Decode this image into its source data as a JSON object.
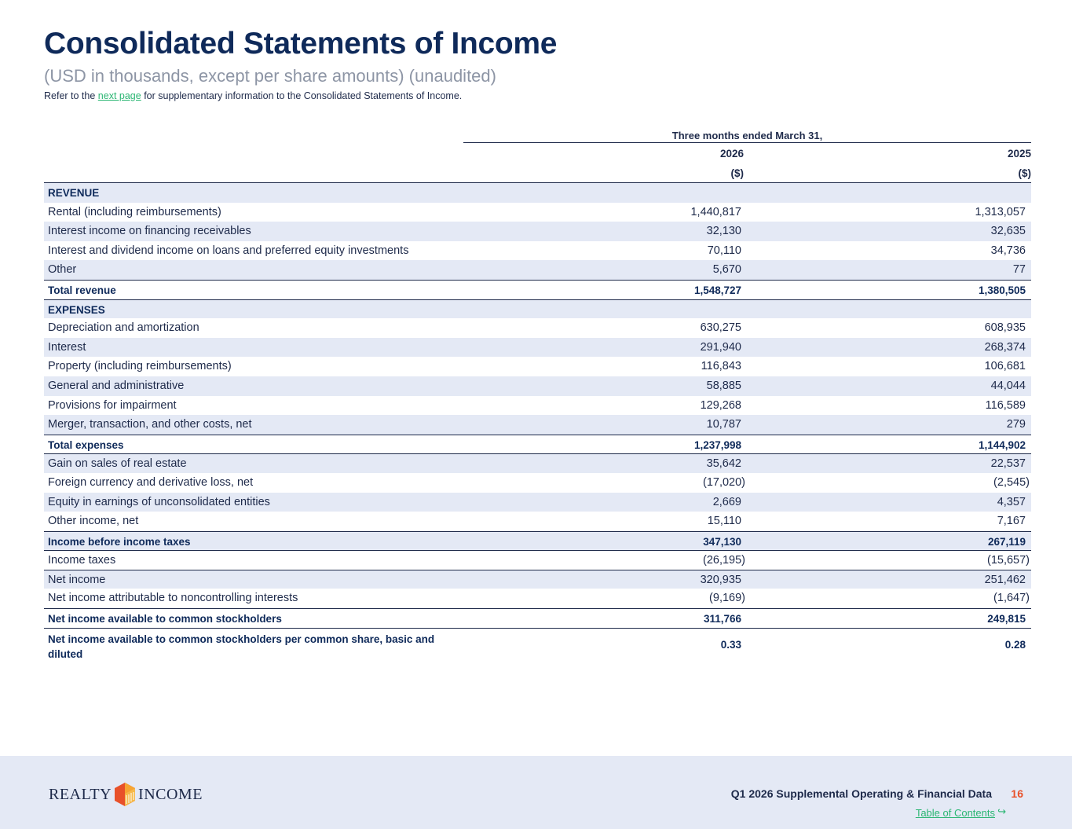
{
  "header": {
    "title": "Consolidated Statements of Income",
    "subtitle": "(USD in thousands, except per share amounts) (unaudited)",
    "note_prefix": "Refer to the ",
    "note_link": "next page",
    "note_suffix": " for supplementary information to the Consolidated Statements of Income."
  },
  "table": {
    "period_label": "Three months ended March 31,",
    "years": [
      "2026",
      "2025"
    ],
    "units": [
      "($)",
      "($)"
    ],
    "rows": [
      {
        "label": "REVENUE",
        "v1": "",
        "v2": ""
      },
      {
        "label": "Rental (including reimbursements)",
        "v1": "1,440,817",
        "v2": "1,313,057"
      },
      {
        "label": "Interest income on financing receivables",
        "v1": "32,130",
        "v2": "32,635"
      },
      {
        "label": "Interest and dividend income on loans and preferred equity investments",
        "v1": "70,110",
        "v2": "34,736"
      },
      {
        "label": "Other",
        "v1": "5,670",
        "v2": "77"
      },
      {
        "label": "Total revenue",
        "v1": "1,548,727",
        "v2": "1,380,505"
      },
      {
        "label": "EXPENSES",
        "v1": "",
        "v2": ""
      },
      {
        "label": "Depreciation and amortization",
        "v1": "630,275",
        "v2": "608,935"
      },
      {
        "label": "Interest",
        "v1": "291,940",
        "v2": "268,374"
      },
      {
        "label": "Property (including reimbursements)",
        "v1": "116,843",
        "v2": "106,681"
      },
      {
        "label": "General and administrative",
        "v1": "58,885",
        "v2": "44,044"
      },
      {
        "label": "Provisions for impairment",
        "v1": "129,268",
        "v2": "116,589"
      },
      {
        "label": "Merger, transaction, and other costs, net",
        "v1": "10,787",
        "v2": "279"
      },
      {
        "label": "Total expenses",
        "v1": "1,237,998",
        "v2": "1,144,902"
      },
      {
        "label": "Gain on sales of real estate",
        "v1": "35,642",
        "v2": "22,537"
      },
      {
        "label": "Foreign currency and derivative loss, net",
        "v1": "(17,020)",
        "v2": "(2,545)"
      },
      {
        "label": "Equity in earnings of unconsolidated entities",
        "v1": "2,669",
        "v2": "4,357"
      },
      {
        "label": "Other income, net",
        "v1": "15,110",
        "v2": "7,167"
      },
      {
        "label": "Income before income taxes",
        "v1": "347,130",
        "v2": "267,119"
      },
      {
        "label": "Income taxes",
        "v1": "(26,195)",
        "v2": "(15,657)"
      },
      {
        "label": "Net income",
        "v1": "320,935",
        "v2": "251,462"
      },
      {
        "label": "Net income attributable to noncontrolling interests",
        "v1": "(9,169)",
        "v2": "(1,647)"
      },
      {
        "label": "Net income available to common stockholders",
        "v1": "311,766",
        "v2": "249,815"
      },
      {
        "label": "Net income available to common stockholders per common share, basic and diluted",
        "v1": "0.33",
        "v2": "0.28"
      }
    ]
  },
  "footer": {
    "logo_left": "REALTY",
    "logo_right": "INCOME",
    "doc_title": "Q1 2026 Supplemental Operating & Financial Data",
    "page_number": "16",
    "toc_link": "Table of Contents",
    "toc_arrow": "↪"
  },
  "colors": {
    "navy": "#0f2a5a",
    "shade": "#e4e9f5",
    "accent_orange": "#e8512a",
    "link_green": "#2bb673"
  }
}
